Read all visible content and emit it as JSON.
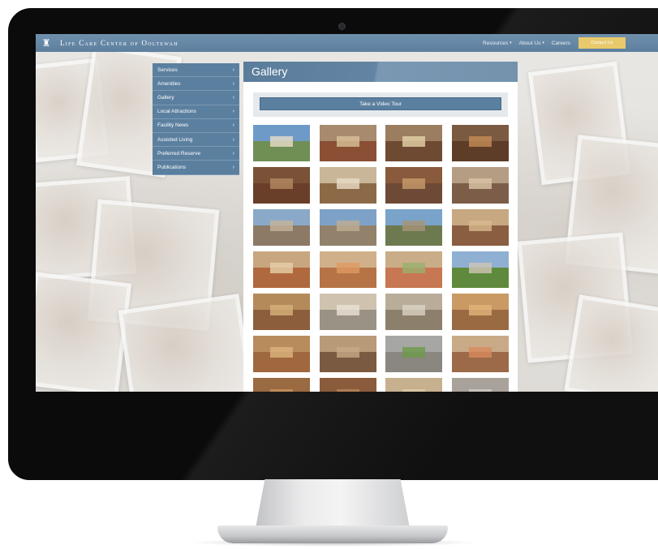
{
  "site": {
    "title": "Life Care Center of Ooltewah",
    "logo_icon": "building-logo-icon"
  },
  "nav": {
    "items": [
      {
        "label": "Resources",
        "has_dropdown": true
      },
      {
        "label": "About Us",
        "has_dropdown": true
      },
      {
        "label": "Careers",
        "has_dropdown": false
      }
    ],
    "contact_label": "Contact Us"
  },
  "sidebar": {
    "items": [
      {
        "label": "Services"
      },
      {
        "label": "Amenities"
      },
      {
        "label": "Gallery"
      },
      {
        "label": "Local Attractions"
      },
      {
        "label": "Facility News"
      },
      {
        "label": "Assisted Living"
      },
      {
        "label": "Preferred Reserve"
      },
      {
        "label": "Publications"
      }
    ]
  },
  "main": {
    "title": "Gallery",
    "video_tour_label": "Take a Video Tour"
  },
  "gallery": {
    "thumbnails": [
      {
        "subject": "building-exterior-flags",
        "top": "#6e9ac8",
        "mid": "#e9dcc8",
        "bottom": "#6f8f55"
      },
      {
        "subject": "lobby-hallway",
        "top": "#a88a6e",
        "mid": "#d8c19a",
        "bottom": "#8a4f35"
      },
      {
        "subject": "lobby-ceiling",
        "top": "#9b7e60",
        "mid": "#e5d2a8",
        "bottom": "#6f4a32"
      },
      {
        "subject": "living-room-fireplace",
        "top": "#7a5a40",
        "mid": "#c58c56",
        "bottom": "#5d3c28"
      },
      {
        "subject": "library-room",
        "top": "#7a5238",
        "mid": "#b48b60",
        "bottom": "#6a3f2a"
      },
      {
        "subject": "reception-desk",
        "top": "#c9b699",
        "mid": "#e8dcc5",
        "bottom": "#8c6a48"
      },
      {
        "subject": "dining-room",
        "top": "#8a5a3c",
        "mid": "#c89b6c",
        "bottom": "#6e4a36"
      },
      {
        "subject": "dining-hall-chandelier",
        "top": "#b49d82",
        "mid": "#d9c6a6",
        "bottom": "#7c5e48"
      },
      {
        "subject": "courtyard-fountain",
        "top": "#8aa9c8",
        "mid": "#c4b49a",
        "bottom": "#8c7a66"
      },
      {
        "subject": "courtyard-gazebo",
        "top": "#7ea2c7",
        "mid": "#bfae92",
        "bottom": "#92826c"
      },
      {
        "subject": "courtyard-garden",
        "top": "#7aa3c9",
        "mid": "#a89478",
        "bottom": "#6d7a4f"
      },
      {
        "subject": "cafe-seating",
        "top": "#c7a880",
        "mid": "#d8b88e",
        "bottom": "#8a5e40"
      },
      {
        "subject": "long-corridor",
        "top": "#c8a680",
        "mid": "#e6cfa9",
        "bottom": "#b0693e"
      },
      {
        "subject": "lounge-orange-chairs",
        "top": "#d0b08a",
        "mid": "#e09a62",
        "bottom": "#b67446"
      },
      {
        "subject": "patient-room",
        "top": "#c9ad88",
        "mid": "#9ab06e",
        "bottom": "#c77752"
      },
      {
        "subject": "exterior-gazebo-lawn",
        "top": "#8fb0d2",
        "mid": "#cfc6b6",
        "bottom": "#5f8a3e"
      },
      {
        "subject": "activity-room",
        "top": "#b58a5a",
        "mid": "#d6b07a",
        "bottom": "#8c5e3c"
      },
      {
        "subject": "therapy-gym-equipment",
        "top": "#cfc3b0",
        "mid": "#e8e2d6",
        "bottom": "#9a9284"
      },
      {
        "subject": "therapy-gym-machines",
        "top": "#b9ad9a",
        "mid": "#d9d2c4",
        "bottom": "#8c7f6c"
      },
      {
        "subject": "rehab-room",
        "top": "#c99a64",
        "mid": "#e2b47c",
        "bottom": "#9a6a42"
      },
      {
        "subject": "salon-room",
        "top": "#b88c5c",
        "mid": "#dcb47e",
        "bottom": "#a0683e"
      },
      {
        "subject": "kitchenette",
        "top": "#b89a78",
        "mid": "#c8a884",
        "bottom": "#7a5a40"
      },
      {
        "subject": "putting-green-courtyard",
        "top": "#a6a6a4",
        "mid": "#6c9a48",
        "bottom": "#8a8680"
      },
      {
        "subject": "private-suite",
        "top": "#c8aa86",
        "mid": "#d88a5c",
        "bottom": "#9c6a48"
      },
      {
        "subject": "room-7a",
        "top": "#9a6a42",
        "mid": "#c89260",
        "bottom": "#7a4e32"
      },
      {
        "subject": "room-7b",
        "top": "#8a5c3c",
        "mid": "#b8845a",
        "bottom": "#6e4630"
      },
      {
        "subject": "room-7c",
        "top": "#c6b08e",
        "mid": "#dccaa8",
        "bottom": "#a08462"
      },
      {
        "subject": "room-7d",
        "top": "#a8a29a",
        "mid": "#d2cac0",
        "bottom": "#8a7a68"
      }
    ]
  },
  "colors": {
    "header": "#5d7f9e",
    "sidebar": "#5b7f9f",
    "contact_button": "#e8c96b",
    "monitor_frame": "#0b0b0c"
  }
}
